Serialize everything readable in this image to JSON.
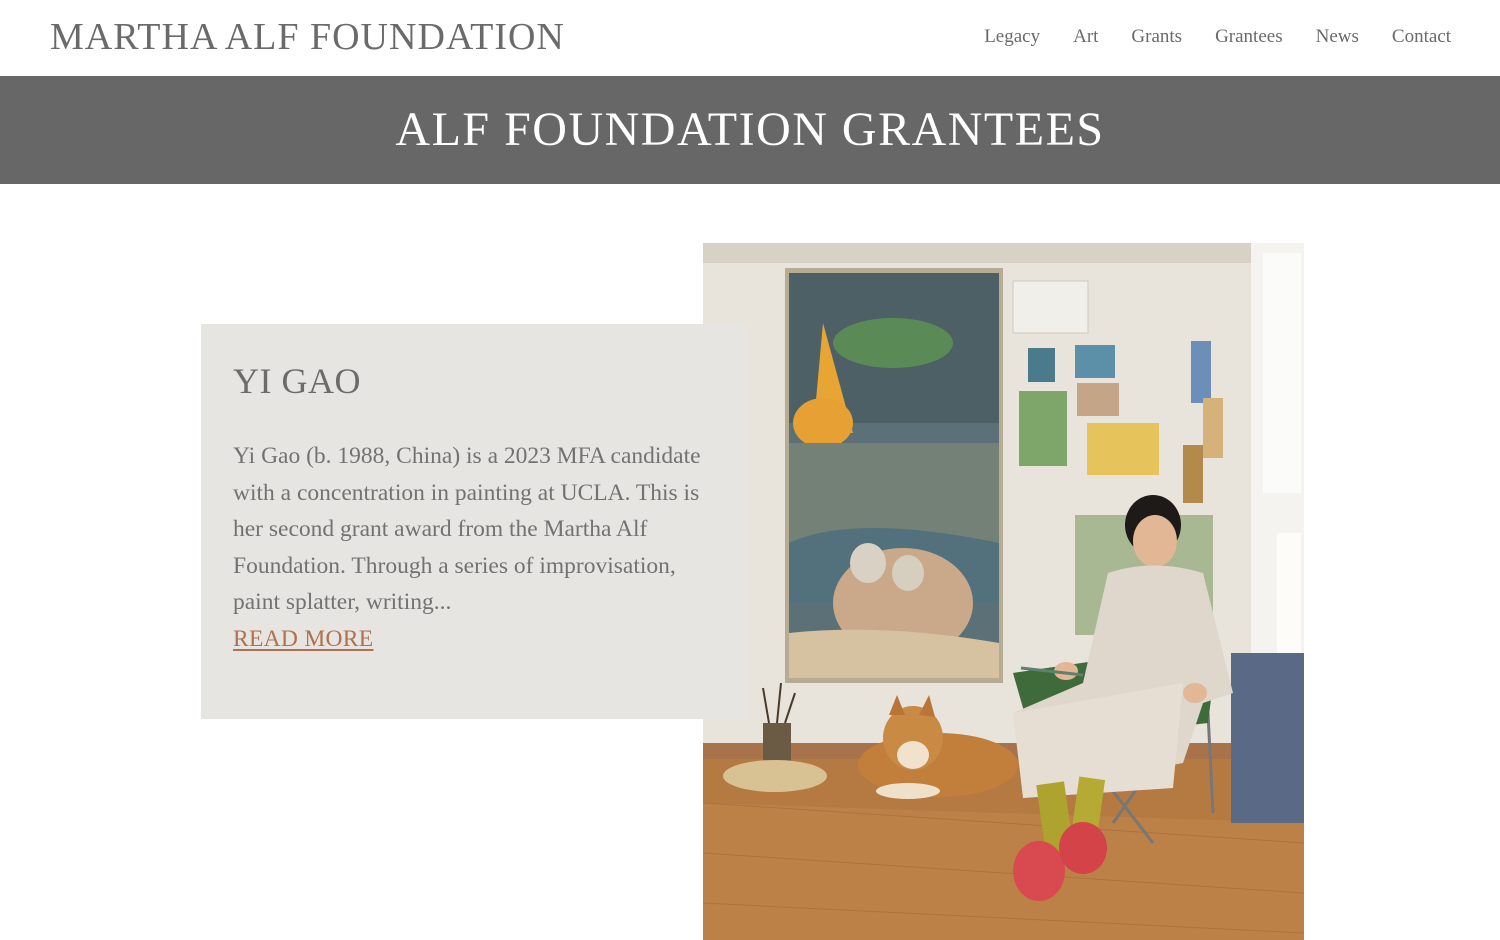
{
  "header": {
    "site_title": "MARTHA ALF FOUNDATION",
    "nav": [
      {
        "label": "Legacy"
      },
      {
        "label": "Art"
      },
      {
        "label": "Grants"
      },
      {
        "label": "Grantees"
      },
      {
        "label": "News"
      },
      {
        "label": "Contact"
      }
    ]
  },
  "banner": {
    "title": "ALF FOUNDATION GRANTEES"
  },
  "grantee": {
    "name": "YI GAO",
    "bio": "Yi Gao (b. 1988, China) is a 2023 MFA candidate with a concentration in painting at UCLA. This is her second grant award from the Martha Alf Foundation. Through a series of improvisation, paint splatter, writing...",
    "read_more": "READ MORE"
  },
  "colors": {
    "banner_bg": "#676767",
    "card_bg": "#e6e5e1",
    "link": "#b0714c",
    "text": "#6b6b6b"
  }
}
